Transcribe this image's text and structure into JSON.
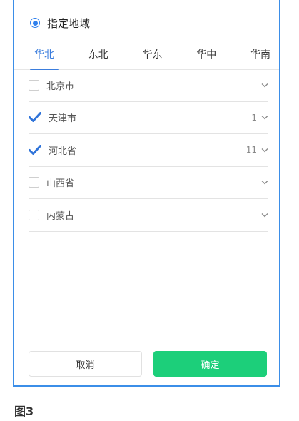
{
  "region": {
    "label": "指定地域",
    "selected": true
  },
  "tabs": [
    {
      "label": "华北",
      "active": true
    },
    {
      "label": "东北",
      "active": false
    },
    {
      "label": "华东",
      "active": false
    },
    {
      "label": "华中",
      "active": false
    },
    {
      "label": "华南",
      "active": false
    }
  ],
  "provinces": [
    {
      "label": "北京市",
      "checked": false,
      "count": ""
    },
    {
      "label": "天津市",
      "checked": true,
      "count": "1"
    },
    {
      "label": "河北省",
      "checked": true,
      "count": "11"
    },
    {
      "label": "山西省",
      "checked": false,
      "count": ""
    },
    {
      "label": "内蒙古",
      "checked": false,
      "count": ""
    }
  ],
  "buttons": {
    "cancel": "取消",
    "confirm": "确定"
  },
  "caption": "图3",
  "colors": {
    "accent": "#3b7ddd",
    "confirm": "#1ccf7a",
    "check": "#2f73d9"
  }
}
